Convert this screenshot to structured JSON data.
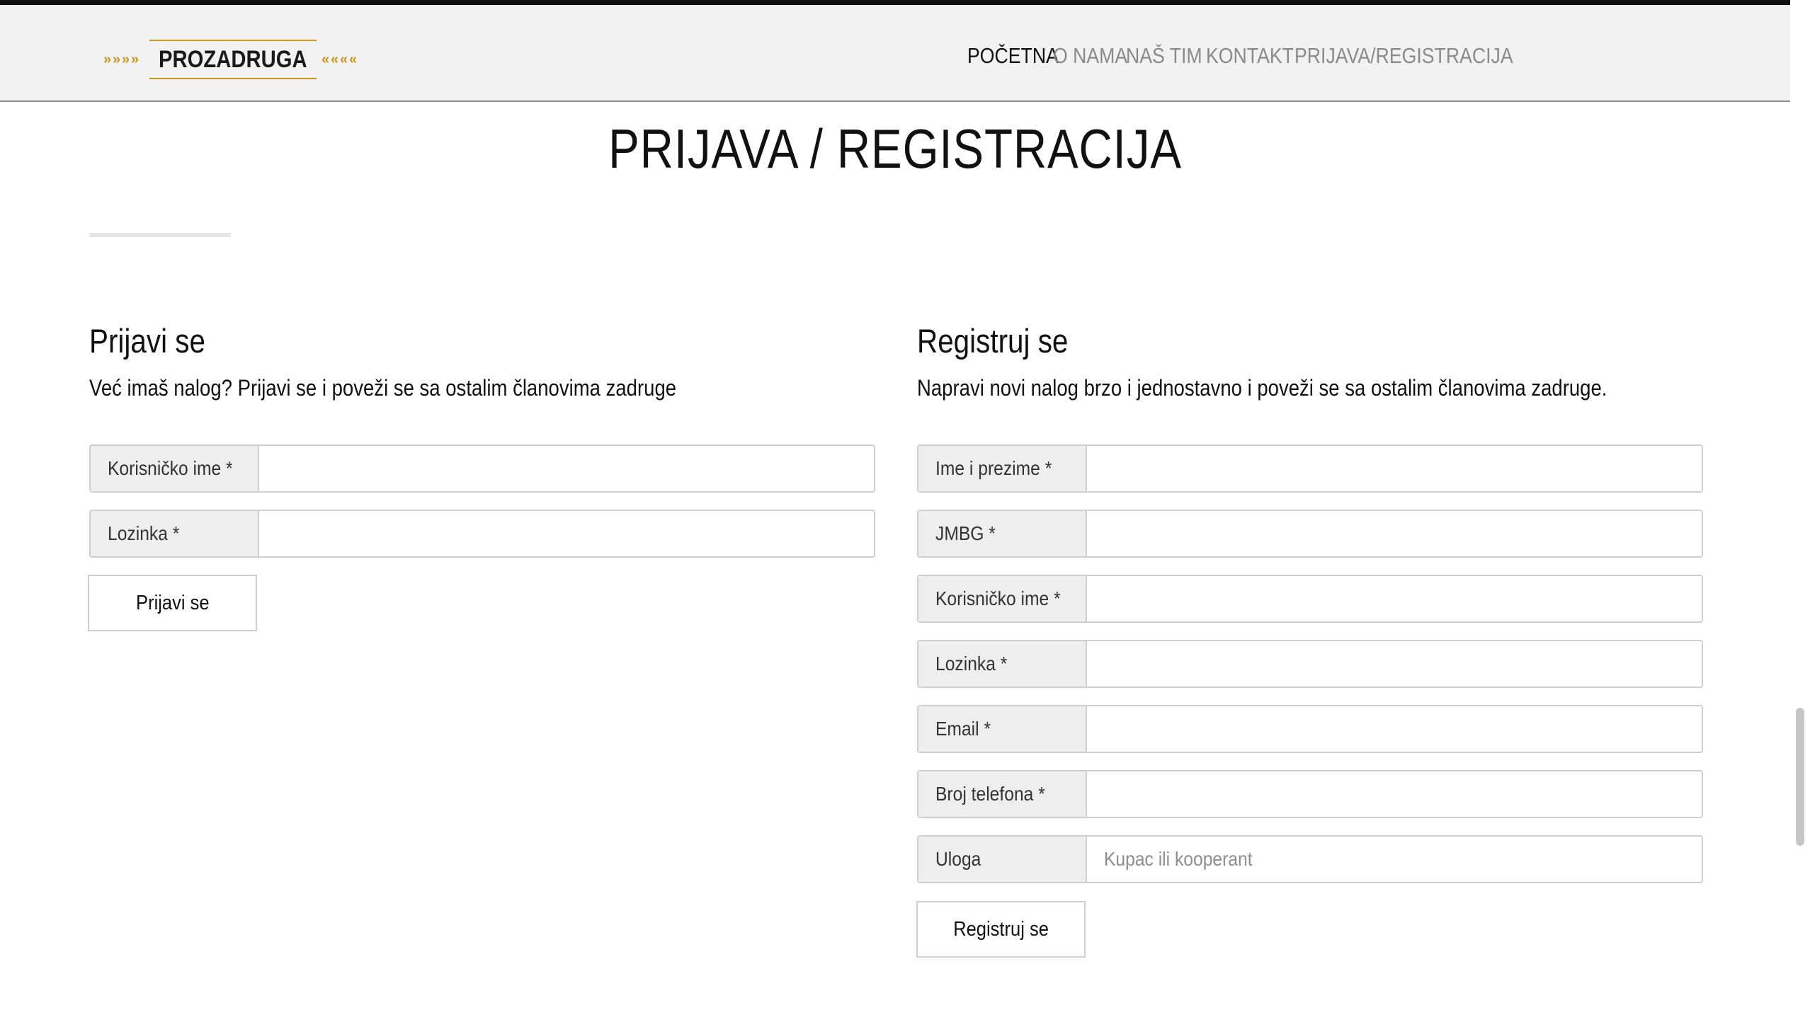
{
  "header": {
    "logo_text": "PROZADRUGA",
    "nav": [
      {
        "label": "POČETNA",
        "active": true
      },
      {
        "label": "O NAMA",
        "active": false
      },
      {
        "label": "NAŠ TIM",
        "active": false
      },
      {
        "label": "KONTAKT",
        "active": false
      },
      {
        "label": "PRIJAVA/REGISTRACIJA",
        "active": false
      }
    ]
  },
  "page": {
    "title": "PRIJAVA / REGISTRACIJA"
  },
  "login": {
    "title": "Prijavi se",
    "description": "Već imaš nalog? Prijavi se i poveži se sa ostalim članovima zadruge",
    "fields": [
      {
        "label": "Korisničko ime *",
        "value": "",
        "placeholder": ""
      },
      {
        "label": "Lozinka *",
        "value": "",
        "placeholder": ""
      }
    ],
    "submit_label": "Prijavi se"
  },
  "register": {
    "title": "Registruj se",
    "description": "Napravi novi nalog brzo i jednostavno i poveži se sa ostalim članovima zadruge.",
    "fields": [
      {
        "label": "Ime i prezime *",
        "value": "",
        "placeholder": ""
      },
      {
        "label": "JMBG *",
        "value": "",
        "placeholder": ""
      },
      {
        "label": "Korisničko ime *",
        "value": "",
        "placeholder": ""
      },
      {
        "label": "Lozinka *",
        "value": "",
        "placeholder": ""
      },
      {
        "label": "Email *",
        "value": "",
        "placeholder": ""
      },
      {
        "label": "Broj telefona *",
        "value": "",
        "placeholder": ""
      },
      {
        "label": "Uloga",
        "value": "",
        "placeholder": "Kupac ili kooperant"
      }
    ],
    "submit_label": "Registruj se"
  },
  "colors": {
    "header_bg": "#f2f2f2",
    "logo_gold": "#c9971c",
    "nav_active": "#111111",
    "nav_inactive": "#8a8a8a",
    "label_bg": "#eeeeee",
    "border": "#cfcfcf"
  },
  "icons": {
    "logo_left": "wheat-icon",
    "logo_right": "wheat-icon"
  }
}
